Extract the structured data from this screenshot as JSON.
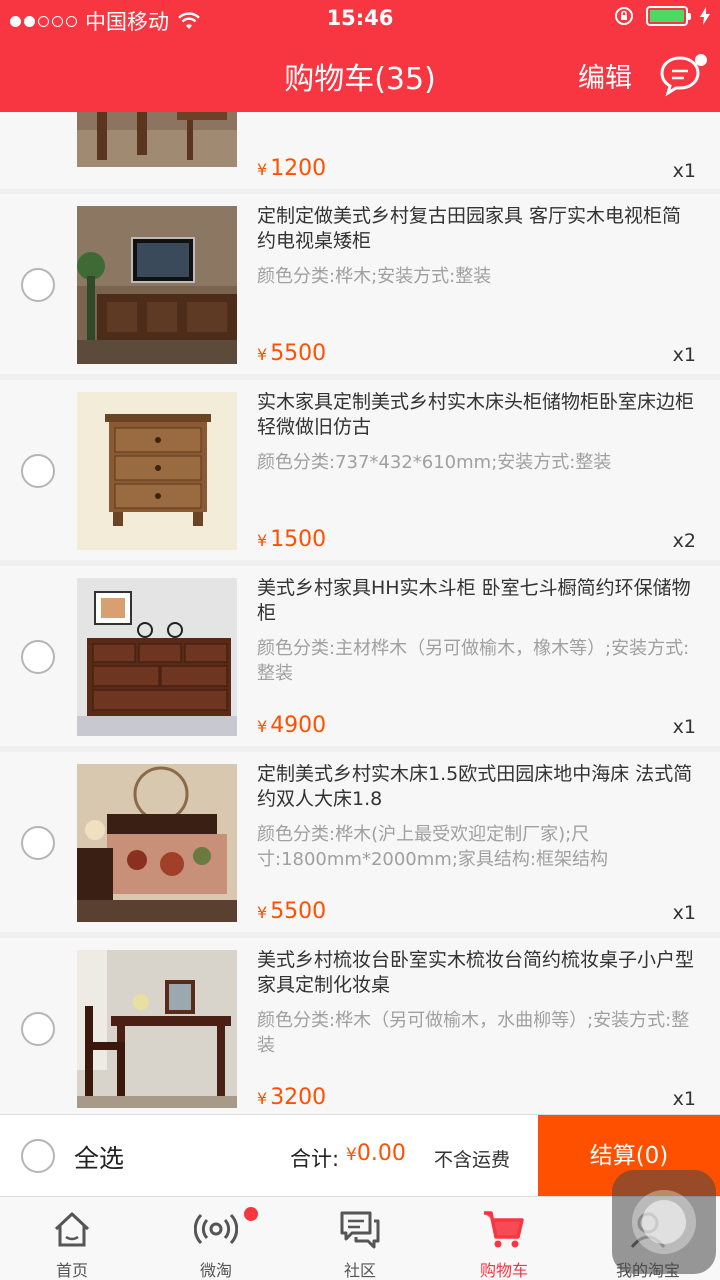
{
  "status_bar": {
    "carrier": "中国移动",
    "time": "15:46"
  },
  "header": {
    "title": "购物车(35)",
    "edit_label": "编辑",
    "message_icon": "message-bubble-icon"
  },
  "cart": {
    "items": [
      {
        "name": "",
        "spec": "",
        "price_symbol": "¥",
        "price": "1200",
        "qty": "x1"
      },
      {
        "name": "定制定做美式乡村复古田园家具 客厅实木电视柜简约电视桌矮柜",
        "spec": "颜色分类:桦木;安装方式:整装",
        "price_symbol": "¥",
        "price": "5500",
        "qty": "x1"
      },
      {
        "name": "实木家具定制美式乡村实木床头柜储物柜卧室床边柜轻微做旧仿古",
        "spec": "颜色分类:737*432*610mm;安装方式:整装",
        "price_symbol": "¥",
        "price": "1500",
        "qty": "x2"
      },
      {
        "name": "美式乡村家具HH实木斗柜 卧室七斗橱简约环保储物柜",
        "spec": "颜色分类:主材桦木（另可做榆木，橡木等）;安装方式:整装",
        "price_symbol": "¥",
        "price": "4900",
        "qty": "x1"
      },
      {
        "name": "定制美式乡村实木床1.5欧式田园床地中海床 法式简约双人大床1.8",
        "spec": "颜色分类:桦木(沪上最受欢迎定制厂家);尺寸:1800mm*2000mm;家具结构:框架结构",
        "price_symbol": "¥",
        "price": "5500",
        "qty": "x1"
      },
      {
        "name": "美式乡村梳妆台卧室实木梳妆台简约梳妆桌子小户型家具定制化妆桌",
        "spec": "颜色分类:桦木（另可做榆木，水曲柳等）;安装方式:整装",
        "price_symbol": "¥",
        "price": "3200",
        "qty": "x1"
      }
    ]
  },
  "summary": {
    "select_all": "全选",
    "total_label": "合计:",
    "total_symbol": "¥",
    "total_value": "0.00",
    "shipping_note": "不含运费",
    "checkout_label": "结算(0)"
  },
  "tabbar": {
    "tabs": [
      {
        "label": "首页",
        "icon": "home-icon"
      },
      {
        "label": "微淘",
        "icon": "broadcast-icon"
      },
      {
        "label": "社区",
        "icon": "community-icon"
      },
      {
        "label": "购物车",
        "icon": "cart-icon"
      },
      {
        "label": "我的淘宝",
        "icon": "profile-icon"
      }
    ],
    "active_index": 3
  },
  "colors": {
    "brand_red": "#f73642",
    "price_orange": "#ff5000",
    "battery_green": "#4cd964"
  }
}
